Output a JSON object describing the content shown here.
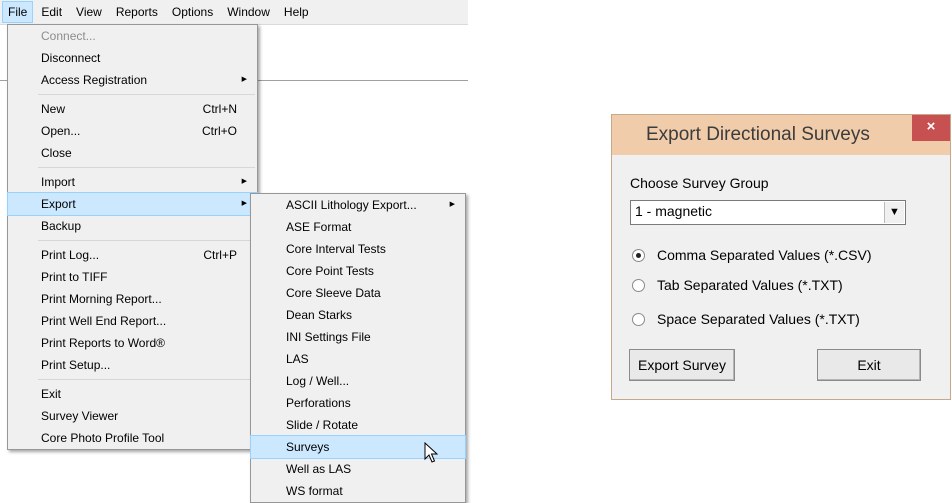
{
  "menubar": {
    "items": [
      "File",
      "Edit",
      "View",
      "Reports",
      "Options",
      "Window",
      "Help"
    ]
  },
  "file_menu": {
    "connect": "Connect...",
    "disconnect": "Disconnect",
    "access_registration": "Access Registration",
    "new": "New",
    "new_shortcut": "Ctrl+N",
    "open": "Open...",
    "open_shortcut": "Ctrl+O",
    "close": "Close",
    "import": "Import",
    "export": "Export",
    "backup": "Backup",
    "print_log": "Print Log...",
    "print_log_shortcut": "Ctrl+P",
    "print_tiff": "Print to TIFF",
    "print_morning": "Print Morning Report...",
    "print_well_end": "Print Well End Report...",
    "print_word": "Print Reports to Word®",
    "print_setup": "Print Setup...",
    "exit": "Exit",
    "survey_viewer": "Survey Viewer",
    "core_photo": "Core Photo Profile Tool"
  },
  "export_submenu": {
    "items": [
      "ASCII Lithology Export...",
      "ASE Format",
      "Core Interval Tests",
      "Core Point Tests",
      "Core Sleeve Data",
      "Dean Starks",
      "INI Settings File",
      "LAS",
      "Log / Well...",
      "Perforations",
      "Slide / Rotate",
      "Surveys",
      "Well as LAS",
      "WS format"
    ],
    "highlighted": "Surveys"
  },
  "dialog": {
    "title": "Export Directional Surveys",
    "close": "×",
    "group_label": "Choose Survey Group",
    "group_value": "1 - magnetic",
    "radio_csv": "Comma Separated Values (*.CSV)",
    "radio_tab": "Tab Separated Values (*.TXT)",
    "radio_space": "Space Separated Values (*.TXT)",
    "selected_radio": "csv",
    "export_button": "Export Survey",
    "exit_button": "Exit"
  },
  "icons": {
    "submenu_arrow": "chevron-right-icon",
    "combo_arrow": "chevron-down-icon",
    "cursor": "mouse-pointer-icon"
  },
  "colors": {
    "highlight": "#cce8ff",
    "dialog_title_bg": "#f1ccaa",
    "close_bg": "#c75050"
  }
}
